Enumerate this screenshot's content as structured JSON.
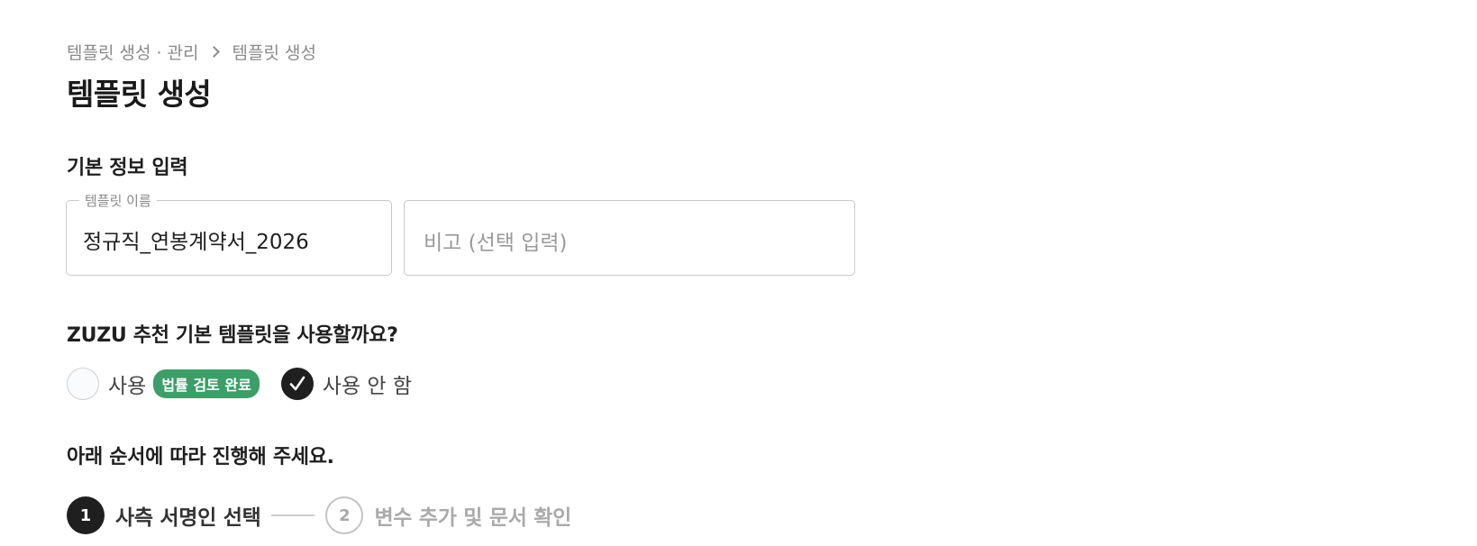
{
  "breadcrumb": {
    "parent": "템플릿 생성 · 관리",
    "current": "템플릿 생성"
  },
  "page_title": "템플릿 생성",
  "basic_info": {
    "section_title": "기본 정보 입력",
    "template_name": {
      "legend": "템플릿 이름",
      "value": "정규직_연봉계약서_2026"
    },
    "note": {
      "placeholder": "비고 (선택 입력)"
    }
  },
  "recommend": {
    "question": "ZUZU 추천 기본 템플릿을 사용할까요?",
    "options": [
      {
        "label": "사용",
        "badge": "법률 검토 완료",
        "selected": false
      },
      {
        "label": "사용 안 함",
        "selected": true
      }
    ],
    "badge_color": "#3c9f68"
  },
  "steps": {
    "instruction": "아래 순서에 따라 진행해 주세요.",
    "items": [
      {
        "number": "1",
        "label": "사측 서명인 선택",
        "active": true
      },
      {
        "number": "2",
        "label": "변수 추가 및 문서 확인",
        "active": false
      }
    ]
  },
  "icons": {
    "breadcrumb_separator": "chevron-right-icon",
    "checked": "checkmark-icon"
  }
}
